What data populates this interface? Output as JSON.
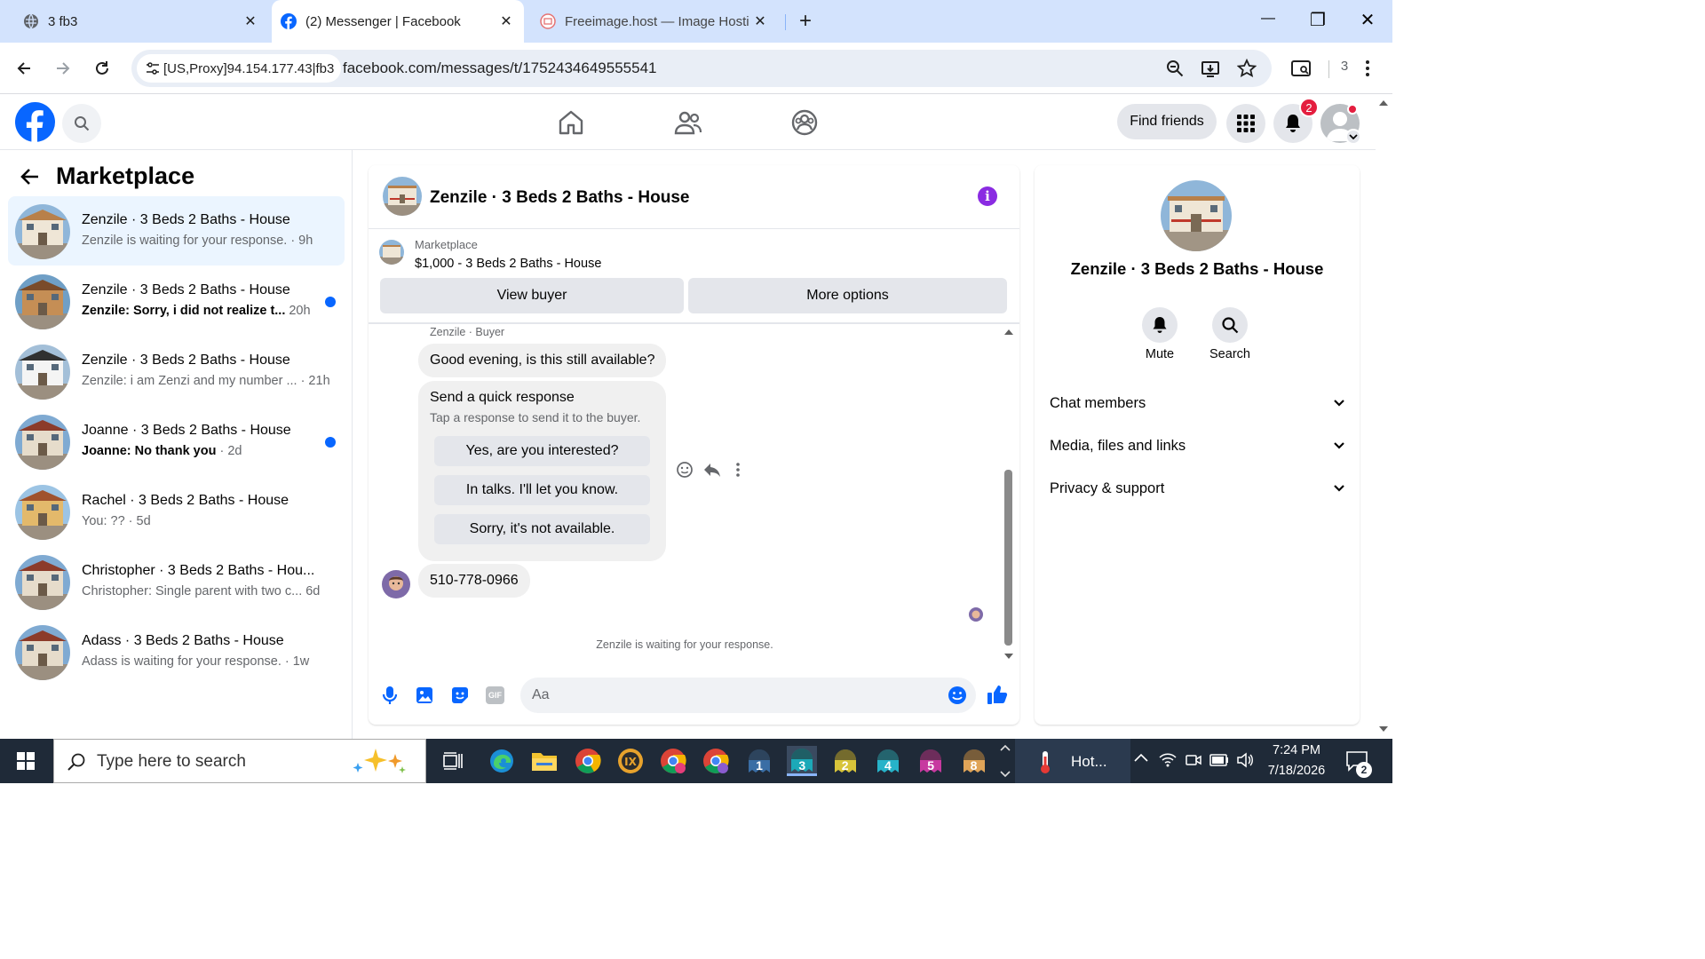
{
  "browser": {
    "tabs": [
      {
        "title": "3 fb3",
        "active": false
      },
      {
        "title": "(2) Messenger | Facebook",
        "active": true
      },
      {
        "title": "Freeimage.host — Image Hosti",
        "active": false
      }
    ],
    "new_tab": "+",
    "window_controls": {
      "minimize": "—",
      "restore": "❐",
      "close": "✕"
    },
    "proxy_label": "[US,Proxy]94.154.177.43|fb3",
    "url": "facebook.com/messages/t/1752434649555541",
    "extension_count": "3"
  },
  "fb": {
    "find_friends": "Find friends",
    "notification_count": "2",
    "brand_color": "#0866ff"
  },
  "sidebar": {
    "title": "Marketplace",
    "conversations": [
      {
        "title": "Zenzile · 3 Beds 2 Baths - House",
        "preview": "Zenzile is waiting for your response.",
        "time": "· 9h",
        "unread": false,
        "selected": true
      },
      {
        "title": "Zenzile · 3 Beds 2 Baths - House",
        "preview": "Zenzile: Sorry, i did not realize t...",
        "time": "20h",
        "unread": true,
        "selected": false
      },
      {
        "title": "Zenzile · 3 Beds 2 Baths - House",
        "preview": "Zenzile: i am Zenzi and my number ...",
        "time": "· 21h",
        "unread": false,
        "selected": false
      },
      {
        "title": "Joanne · 3 Beds 2 Baths - House",
        "preview": "Joanne: No thank you",
        "time": "· 2d",
        "unread": true,
        "selected": false
      },
      {
        "title": "Rachel · 3 Beds 2 Baths - House",
        "preview": "You: ??",
        "time": "· 5d",
        "unread": false,
        "selected": false
      },
      {
        "title": "Christopher · 3 Beds 2 Baths - Hou...",
        "preview": "Christopher: Single parent with two c...",
        "time": "6d",
        "unread": false,
        "selected": false
      },
      {
        "title": "Adass · 3 Beds 2 Baths - House",
        "preview": "Adass is waiting for your response.",
        "time": "· 1w",
        "unread": false,
        "selected": false
      }
    ]
  },
  "chat": {
    "header_title": "Zenzile · 3 Beds 2 Baths - House",
    "listing_label": "Marketplace",
    "listing_detail": "$1,000 - 3 Beds 2 Baths - House",
    "view_buyer": "View buyer",
    "more_options": "More options",
    "sender_label": "Zenzile · Buyer",
    "message_1": "Good evening, is this still available?",
    "quick_title": "Send a quick response",
    "quick_subtitle": "Tap a response to send it to the buyer.",
    "quick_replies": [
      "Yes, are you interested?",
      "In talks. I'll let you know.",
      "Sorry, it's not available."
    ],
    "message_2": "510-778-0966",
    "status": "Zenzile is waiting for your response.",
    "composer_placeholder": "Aa",
    "accent_color": "#8a2be2"
  },
  "details": {
    "title": "Zenzile · 3 Beds 2 Baths - House",
    "mute": "Mute",
    "search": "Search",
    "sections": [
      "Chat members",
      "Media, files and links",
      "Privacy & support"
    ]
  },
  "taskbar": {
    "search_placeholder": "Type here to search",
    "weather": "Hot...",
    "time": "7:24 PM",
    "date": "7/18/2026",
    "notifications": "2",
    "profile_badges": [
      "1",
      "3",
      "2",
      "4",
      "5",
      "8"
    ]
  }
}
